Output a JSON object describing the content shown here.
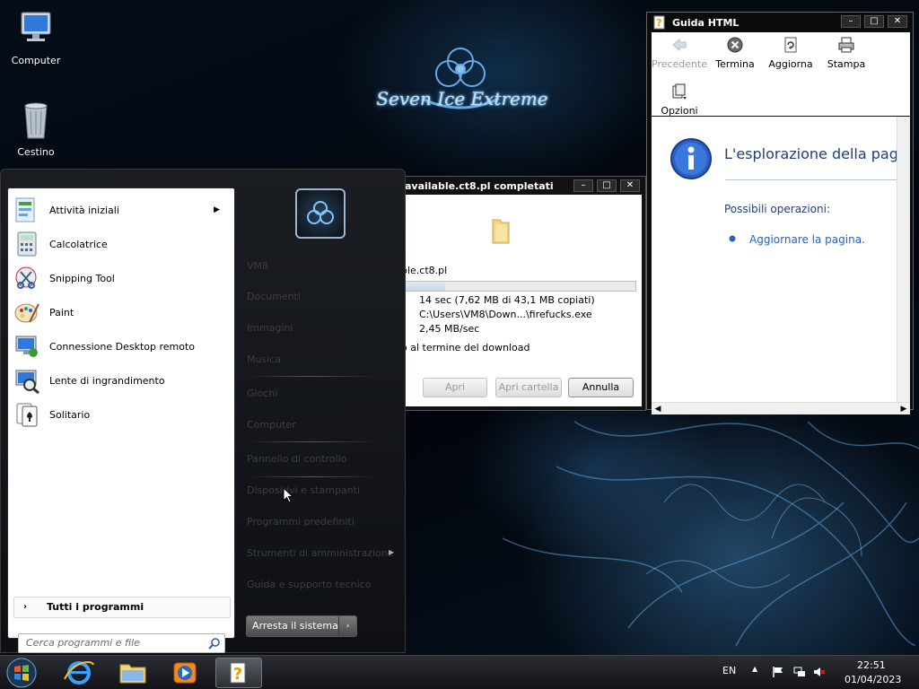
{
  "desktop": {
    "icons": [
      {
        "label": "Computer",
        "icon": "computer-icon"
      },
      {
        "label": "Cestino",
        "icon": "recycle-bin-icon"
      }
    ],
    "wallpaper_text": "Seven Ice Extreme"
  },
  "download_window": {
    "title": "available.ct8.pl completati",
    "filename": "ble.ct8.pl",
    "progress_fraction": 0.18,
    "time_remaining": "14 sec (7,62 MB di 43,1 MB copiati)",
    "target_path": "C:\\Users\\VM8\\Down...\\firefucks.exe",
    "rate": "2,45 MB/sec",
    "close_when_done": "o al termine del download",
    "buttons": {
      "open": "Apri",
      "open_folder": "Apri cartella",
      "cancel": "Annulla"
    }
  },
  "help_window": {
    "title": "Guida HTML",
    "toolbar": {
      "back": "Precedente",
      "stop": "Termina",
      "refresh": "Aggiorna",
      "print": "Stampa",
      "options": "Opzioni"
    },
    "heading": "L'esplorazione della pag",
    "possible_actions": "Possibili operazioni:",
    "refresh_link": "Aggiornare la pagina."
  },
  "start_menu": {
    "programs": [
      {
        "label": "Attività iniziali",
        "icon": "getting-started-icon",
        "has_submenu": true
      },
      {
        "label": "Calcolatrice",
        "icon": "calculator-icon"
      },
      {
        "label": "Snipping Tool",
        "icon": "snipping-tool-icon"
      },
      {
        "label": "Paint",
        "icon": "paint-icon"
      },
      {
        "label": "Connessione Desktop remoto",
        "icon": "remote-desktop-icon"
      },
      {
        "label": "Lente di ingrandimento",
        "icon": "magnifier-icon"
      },
      {
        "label": "Solitario",
        "icon": "solitaire-icon"
      }
    ],
    "all_programs": "Tutti i programmi",
    "search_placeholder": "Cerca programmi e file",
    "right_items": [
      "VM8",
      "Documenti",
      "Immagini",
      "Musica",
      "Giochi",
      "Computer",
      "Pannello di controllo",
      "Dispositivi e stampanti",
      "Programmi predefiniti",
      "Strumenti di amministrazione",
      "Guida e supporto tecnico"
    ],
    "shutdown": "Arresta il sistema"
  },
  "taskbar": {
    "apps": [
      {
        "name": "Internet Explorer",
        "icon": "internet-explorer-icon"
      },
      {
        "name": "Esplora risorse",
        "icon": "file-explorer-icon"
      },
      {
        "name": "Windows Media Player",
        "icon": "media-player-icon"
      },
      {
        "name": "Guida HTML",
        "icon": "help-file-icon",
        "active": true
      }
    ],
    "language": "EN",
    "time": "22:51",
    "date": "01/04/2023"
  }
}
